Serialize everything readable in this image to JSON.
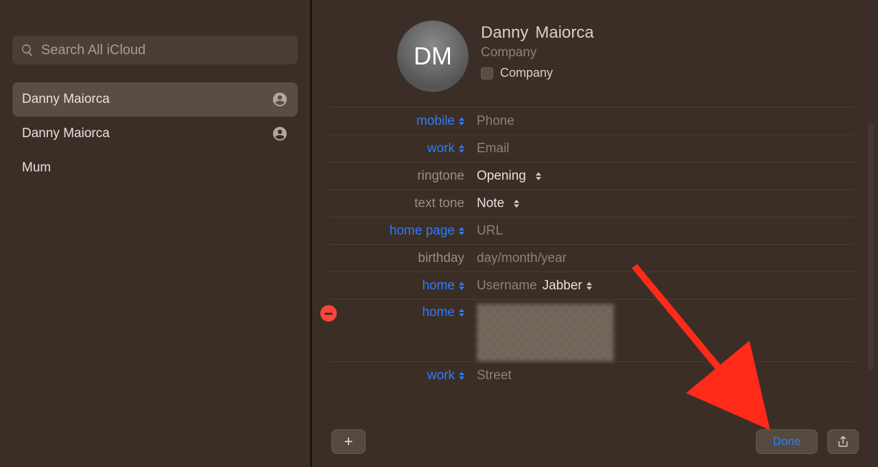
{
  "search": {
    "placeholder": "Search All iCloud"
  },
  "contacts": [
    {
      "name": "Danny  Maiorca",
      "selected": true,
      "hasPic": true
    },
    {
      "name": "Danny Maiorca",
      "selected": false,
      "hasPic": true
    },
    {
      "name": "Mum",
      "selected": false,
      "hasPic": false
    }
  ],
  "card": {
    "initials": "DM",
    "first": "Danny",
    "last": "Maiorca",
    "company_placeholder": "Company",
    "company_checkbox_label": "Company"
  },
  "fields": {
    "mobile_label": "mobile",
    "mobile_ph": "Phone",
    "work_email_label": "work",
    "work_email_ph": "Email",
    "ringtone_label": "ringtone",
    "ringtone_value": "Opening",
    "texttone_label": "text tone",
    "texttone_value": "Note",
    "homepage_label": "home page",
    "homepage_ph": "URL",
    "birthday_label": "birthday",
    "birthday_ph": "day/month/year",
    "im_label": "home",
    "im_ph": "Username",
    "im_service": "Jabber",
    "addr_home_label": "home",
    "addr_work_label": "work",
    "addr_work_ph": "Street"
  },
  "footer": {
    "done": "Done"
  }
}
